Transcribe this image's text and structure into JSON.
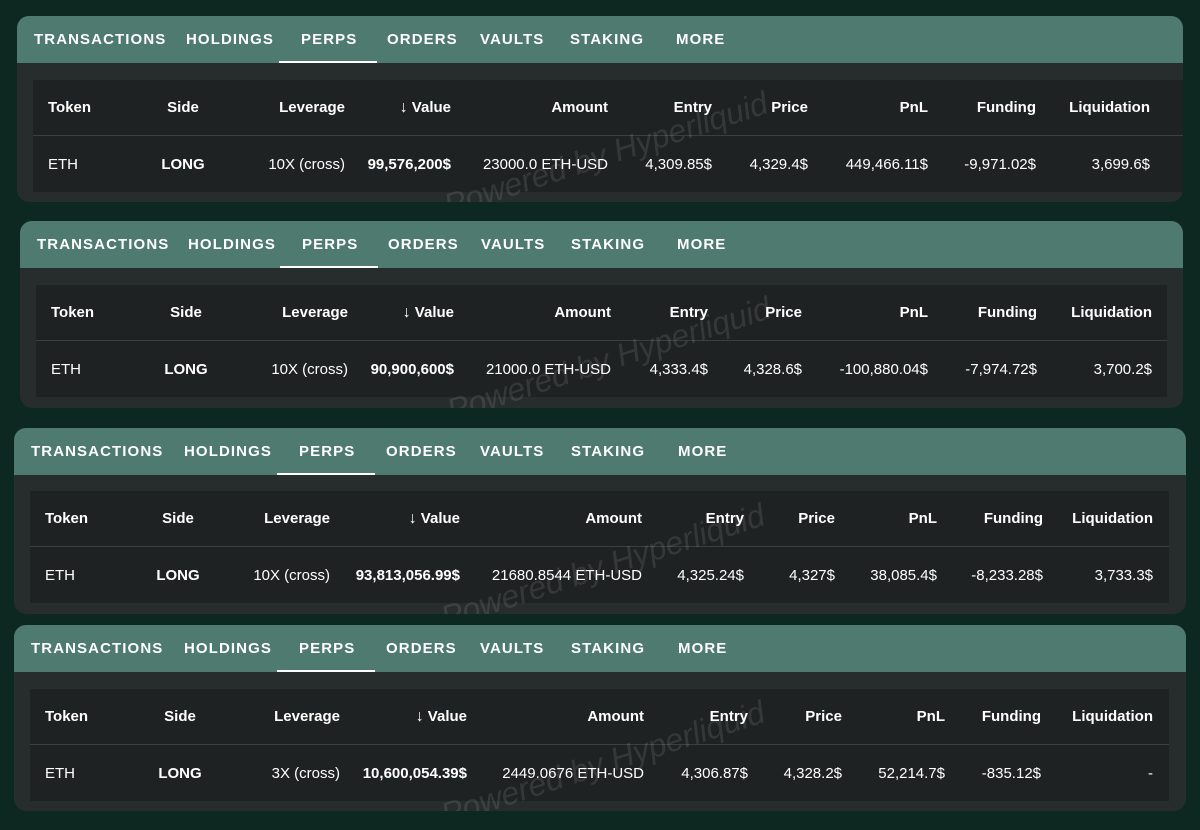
{
  "tabs": [
    "TRANSACTIONS",
    "HOLDINGS",
    "PERPS",
    "ORDERS",
    "VAULTS",
    "STAKING",
    "MORE"
  ],
  "active_tab": "PERPS",
  "columns": [
    "Token",
    "Side",
    "Leverage",
    "Value",
    "Amount",
    "Entry",
    "Price",
    "PnL",
    "Funding",
    "Liquidation"
  ],
  "watermark": "Powered by Hyperliquid",
  "panels": [
    {
      "token": "ETH",
      "side": "LONG",
      "leverage": "10X (cross)",
      "value": "99,576,200$",
      "amount": "23000.0 ETH-USD",
      "entry": "4,309.85$",
      "price": "4,329.4$",
      "pnl": "449,466.11$",
      "funding": "-9,971.02$",
      "liquidation": "3,699.6$"
    },
    {
      "token": "ETH",
      "side": "LONG",
      "leverage": "10X (cross)",
      "value": "90,900,600$",
      "amount": "21000.0 ETH-USD",
      "entry": "4,333.4$",
      "price": "4,328.6$",
      "pnl": "-100,880.04$",
      "funding": "-7,974.72$",
      "liquidation": "3,700.2$"
    },
    {
      "token": "ETH",
      "side": "LONG",
      "leverage": "10X (cross)",
      "value": "93,813,056.99$",
      "amount": "21680.8544 ETH-USD",
      "entry": "4,325.24$",
      "price": "4,327$",
      "pnl": "38,085.4$",
      "funding": "-8,233.28$",
      "liquidation": "3,733.3$"
    },
    {
      "token": "ETH",
      "side": "LONG",
      "leverage": "3X (cross)",
      "value": "10,600,054.39$",
      "amount": "2449.0676 ETH-USD",
      "entry": "4,306.87$",
      "price": "4,328.2$",
      "pnl": "52,214.7$",
      "funding": "-835.12$",
      "liquidation": "-"
    }
  ],
  "colors": {
    "long": "#1fa51f",
    "pnl_positive": "#1f8a1f",
    "negative": "#ee1c1c",
    "tabbar": "#4e7a70"
  }
}
